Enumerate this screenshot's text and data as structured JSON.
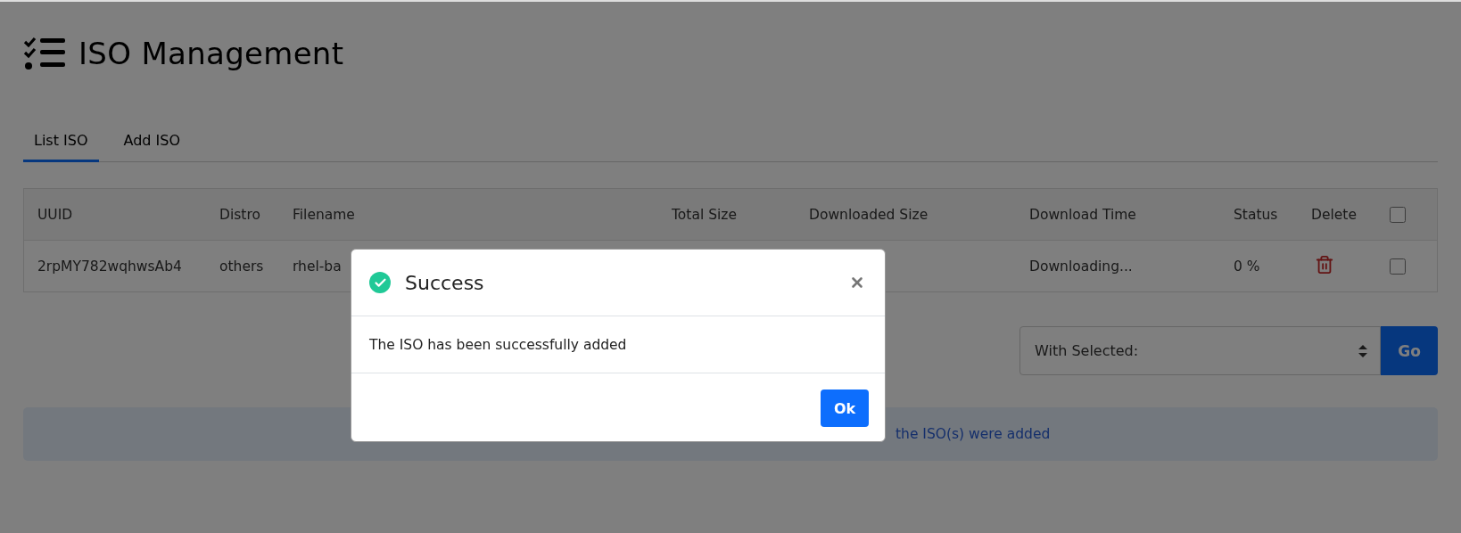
{
  "page": {
    "title": "ISO Management"
  },
  "tabs": [
    {
      "label": "List ISO",
      "selected": true
    },
    {
      "label": "Add ISO",
      "selected": false
    }
  ],
  "table": {
    "columns": [
      "UUID",
      "Distro",
      "Filename",
      "Total Size",
      "Downloaded Size",
      "Download Time",
      "Status",
      "Delete"
    ],
    "header_checkbox": {
      "checked": false
    },
    "rows": [
      {
        "uuid": "2rpMY782wqhwsAb4",
        "distro": "others",
        "filename": "rhel-ba",
        "download_time": "Downloading...",
        "status": "0 %",
        "checked": false
      }
    ]
  },
  "bulk_action": {
    "select_value": "With Selected:",
    "button": "Go"
  },
  "alert": {
    "text": "the ISO(s) were added"
  },
  "modal": {
    "title": "Success",
    "message": "The ISO has been successfully added",
    "button": "Ok"
  }
}
